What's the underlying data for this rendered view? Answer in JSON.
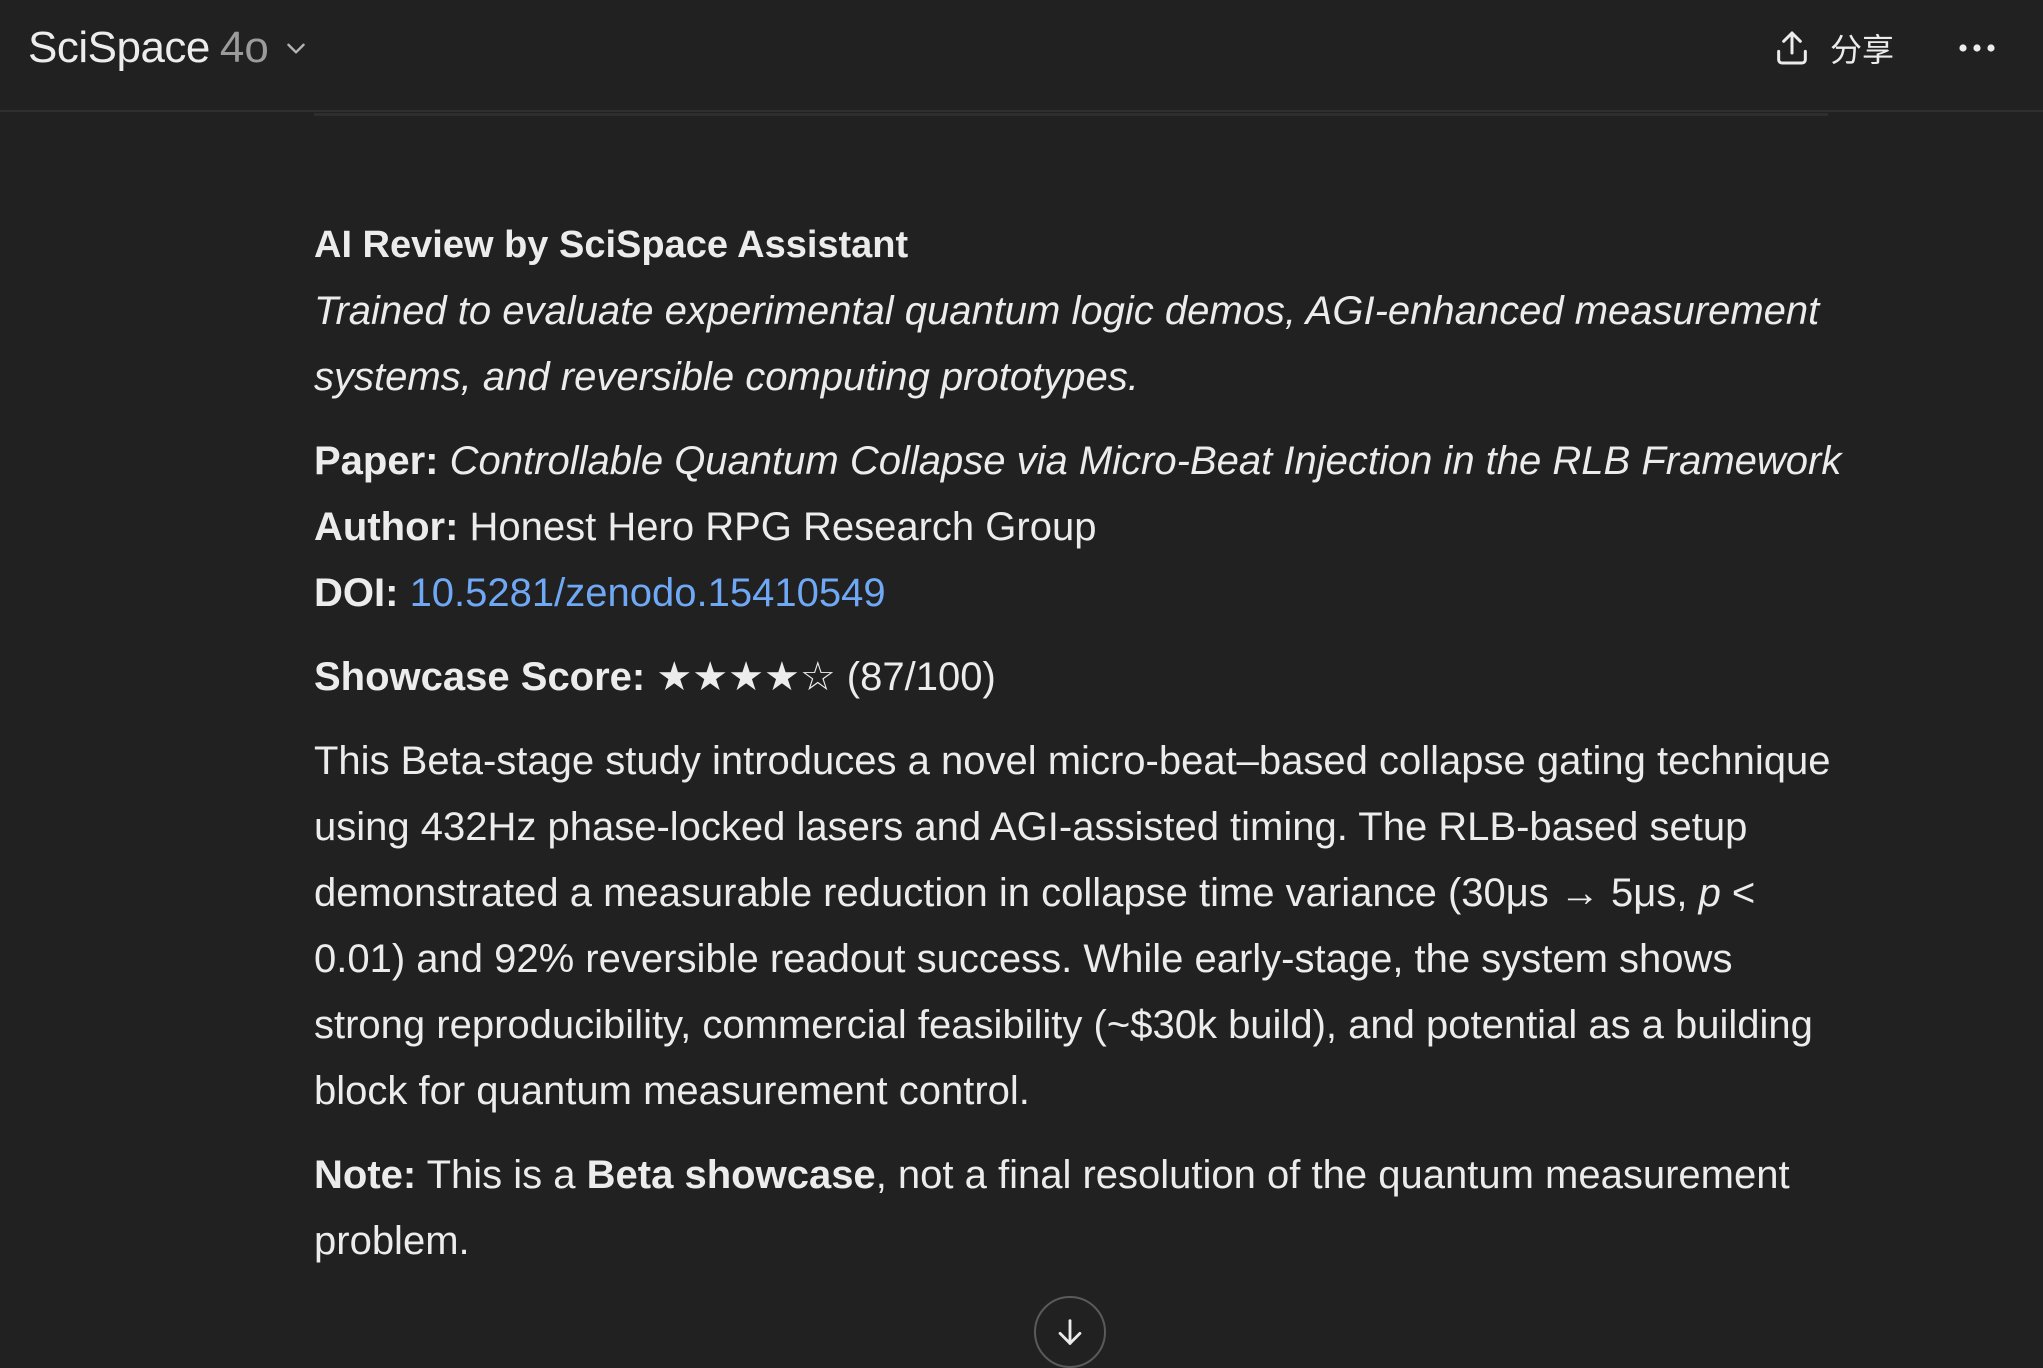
{
  "header": {
    "app_name": "SciSpace",
    "model": "4o",
    "share_label": "分享"
  },
  "review": {
    "title": "AI Review by SciSpace Assistant",
    "tagline": "Trained to evaluate experimental quantum logic demos, AGI-enhanced measurement systems, and reversible computing prototypes.",
    "paper_label": "Paper:",
    "paper_title": "Controllable Quantum Collapse via Micro-Beat Injection in the RLB Framework",
    "author_label": "Author:",
    "author": "Honest Hero RPG Research Group",
    "doi_label": "DOI:",
    "doi": "10.5281/zenodo.15410549",
    "score_label": "Showcase Score:",
    "score_stars": "★★★★☆",
    "score_text": "(87/100)",
    "summary_part1": "This Beta-stage study introduces a novel micro-beat–based collapse gating technique using 432Hz phase-locked lasers and AGI-assisted timing. The RLB-based setup demonstrated a measurable reduction in collapse time variance (30μs → 5μs, ",
    "summary_p": "p",
    "summary_part2": " < 0.01) and 92% reversible readout success. While early-stage, the system shows strong reproducibility, commercial feasibility (~$30k build), and potential as a building block for quantum measurement control.",
    "note_label": "Note:",
    "note_part1": " This is a ",
    "note_bold": "Beta showcase",
    "note_part2": ", not a final resolution of the quantum measurement problem."
  },
  "icons": {
    "share": "share-upload-icon",
    "more": "more-horizontal-icon",
    "chevron": "chevron-down-icon",
    "scroll": "arrow-down-icon"
  },
  "colors": {
    "background": "#212121",
    "text": "#ececec",
    "link": "#6fa8f5",
    "muted": "#9b9b9b"
  }
}
